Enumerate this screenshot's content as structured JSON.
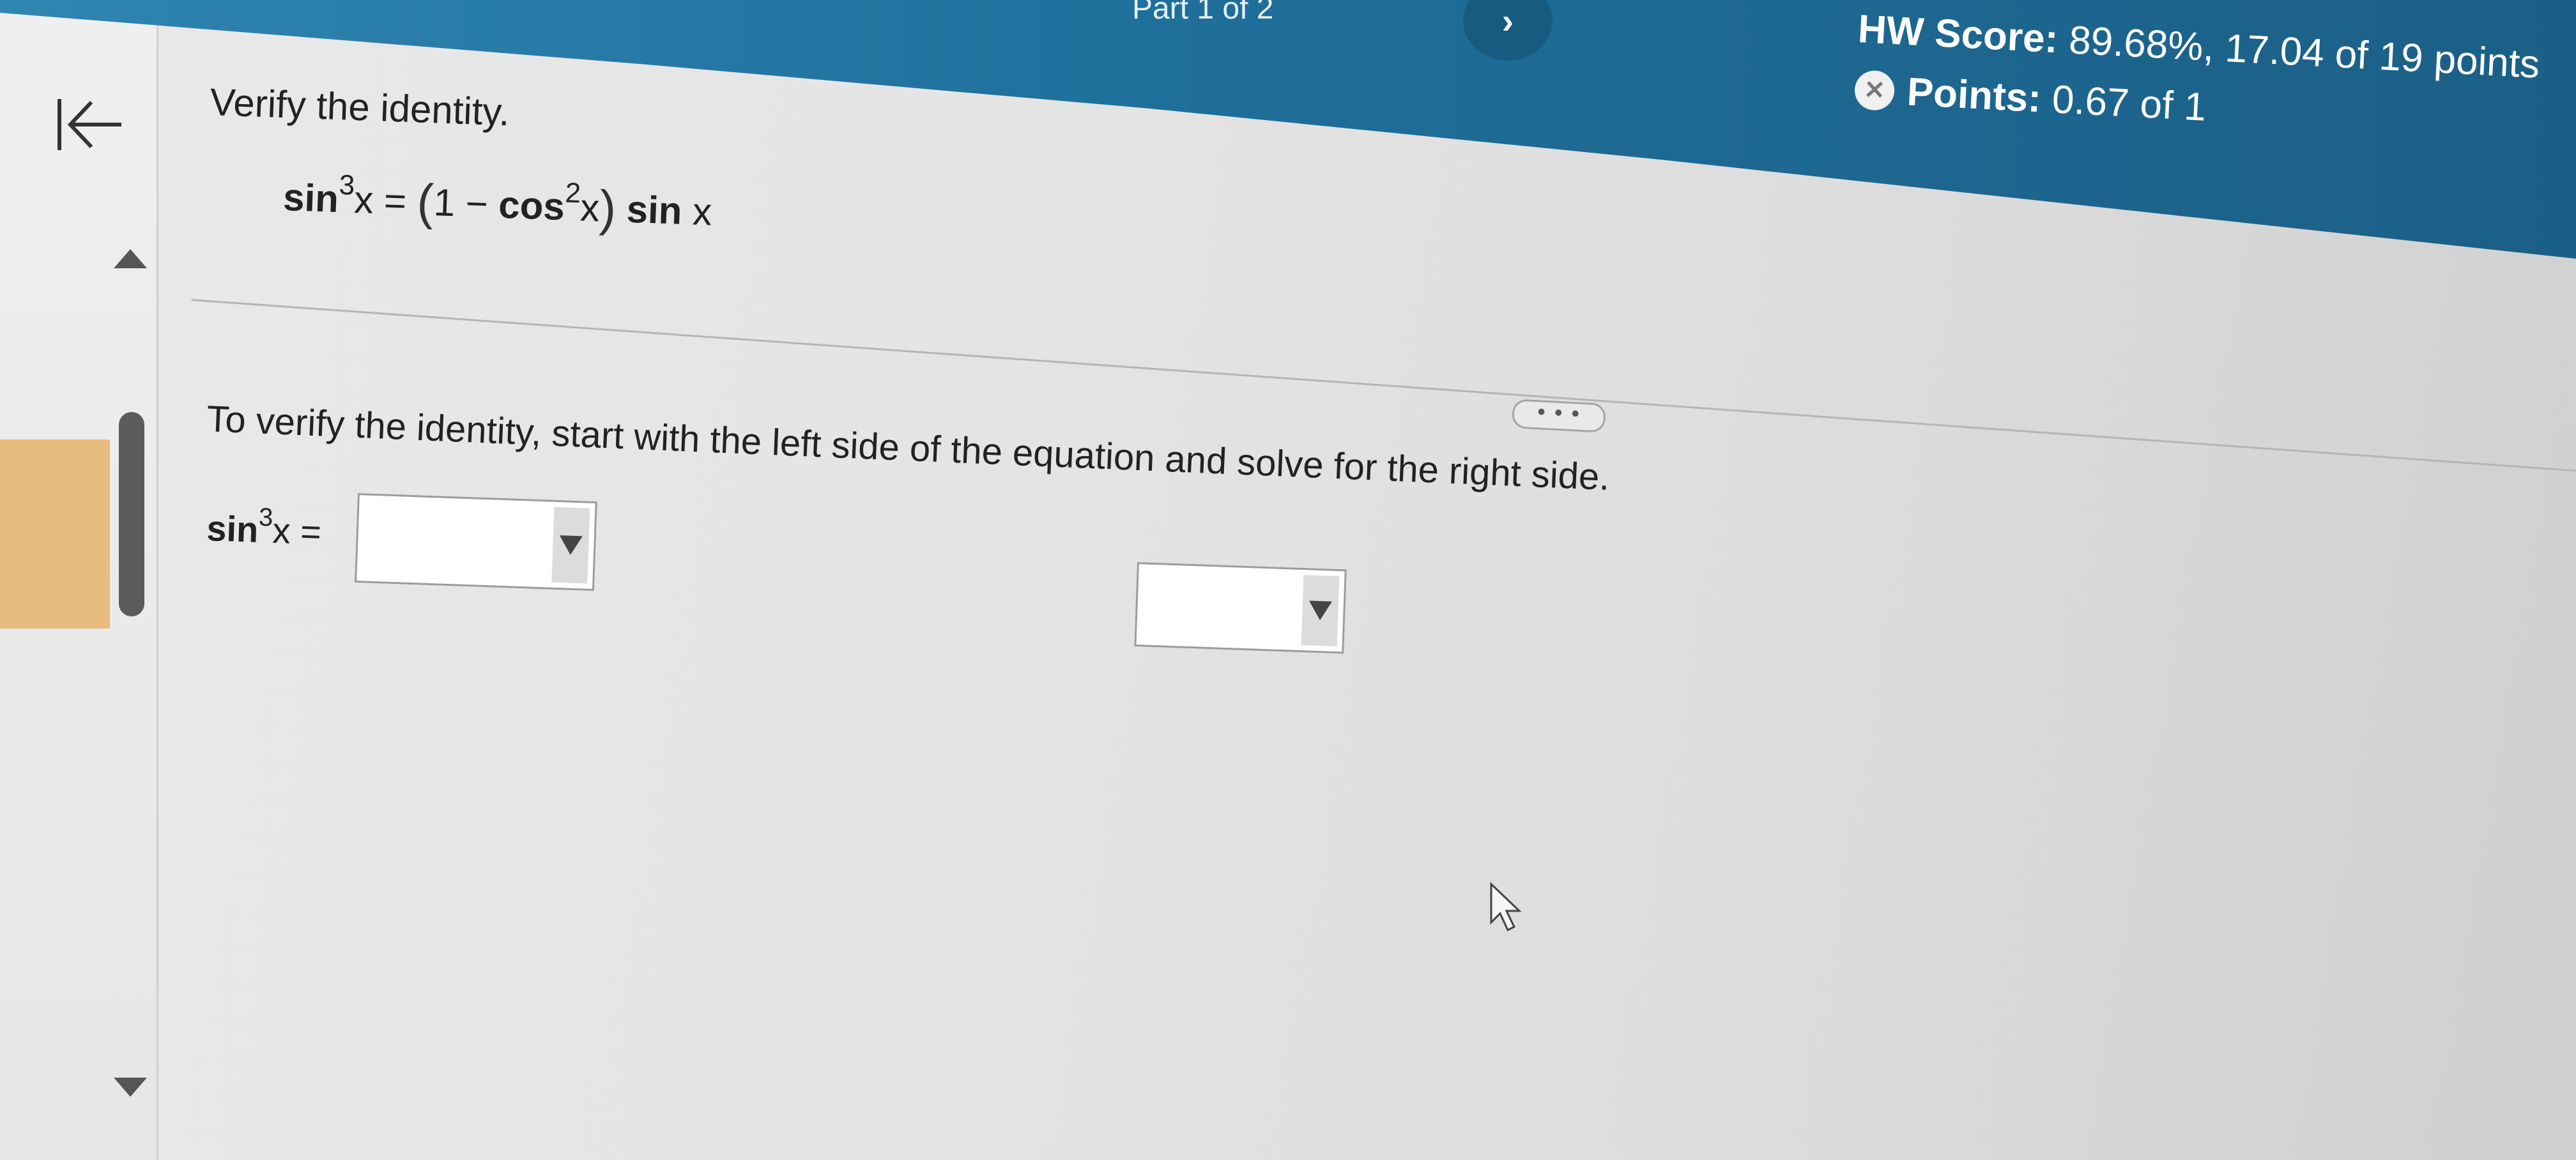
{
  "header": {
    "part_label": "Part 1 of 2",
    "next_symbol": "›",
    "hw_score_label": "HW Score:",
    "hw_score_value": "89.68%, 17.04 of 19 points",
    "points_label": "Points:",
    "points_value": "0.67 of 1"
  },
  "question": {
    "title": "Verify the identity.",
    "equation": {
      "lhs_fn": "sin",
      "lhs_exp": "3",
      "lhs_var": "x",
      "equals": " = ",
      "open_paren": "(",
      "one_minus": "1 − ",
      "cos_fn": "cos",
      "cos_exp": "2",
      "cos_var": "x",
      "close_paren": ")",
      "sin_fn": " sin",
      "sin_var": " x"
    },
    "more_label": "• • •",
    "instruction": "To verify the identity, start with the left side of the equation and solve for the right side.",
    "step": {
      "fn": "sin",
      "exp": "3",
      "var": "x",
      "equals": " ="
    }
  },
  "colors": {
    "banner": "#1f6f9b",
    "accent_orange": "#e8bc7e",
    "scroll_thumb": "#5b5b5b"
  },
  "icons": {
    "back": "arrow-left-to-bar-icon",
    "partial_credit": "partial-credit-icon",
    "next": "chevron-right-icon",
    "dropdown": "triangle-down-icon",
    "cursor": "mouse-pointer-icon"
  }
}
